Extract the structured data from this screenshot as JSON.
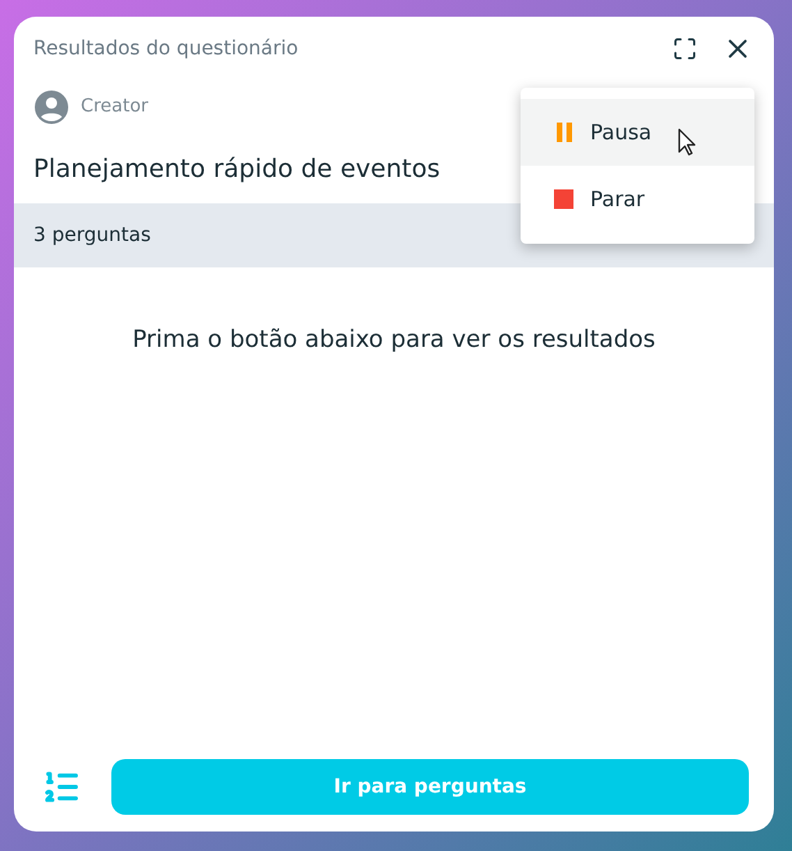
{
  "window": {
    "title": "Resultados do questionário"
  },
  "author": {
    "name": "Creator"
  },
  "quiz": {
    "title": "Planejamento rápido de eventos",
    "question_count": "3 perguntas"
  },
  "message": "Prima o botão abaixo para ver os resultados",
  "menu": {
    "items": [
      {
        "kind": "pause",
        "label": "Pausa",
        "selected": true
      },
      {
        "kind": "stop",
        "label": "Parar",
        "selected": false
      }
    ]
  },
  "footer": {
    "button": "Ir para perguntas"
  }
}
